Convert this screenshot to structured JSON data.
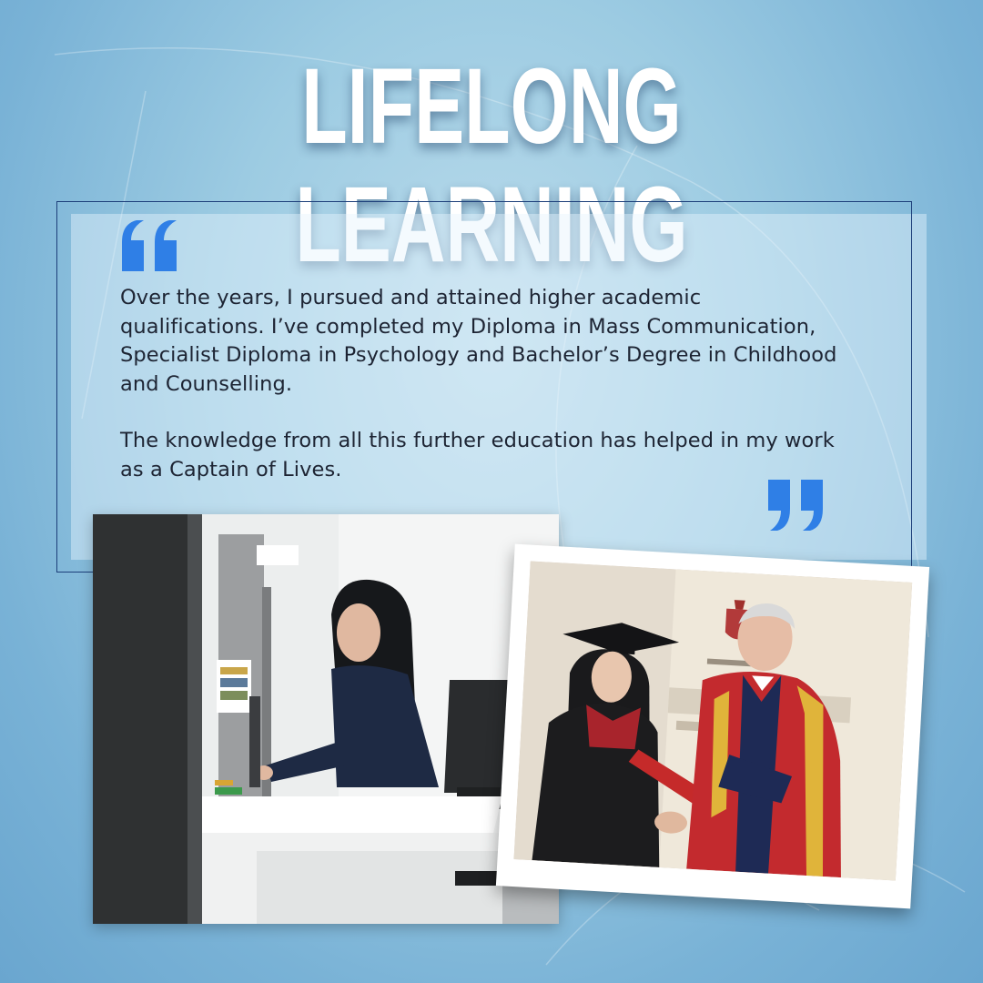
{
  "header": {
    "title": "LIFELONG LEARNING"
  },
  "quote": {
    "paragraphs": [
      "Over the years, I pursued and attained higher academic qualifications. I’ve completed my Diploma in Mass Communication, Specialist Diploma in Psychology and Bachelor’s Degree in Childhood and Counselling.",
      "The knowledge from all this further education has helped in my work as a Captain of Lives."
    ]
  },
  "colors": {
    "accent": "#2f7fe6",
    "frame": "#1d3f7a",
    "title": "#ffffff",
    "text": "#1d2433"
  },
  "icons": {
    "open_quote": "open-quote-icon",
    "close_quote": "close-quote-icon"
  }
}
